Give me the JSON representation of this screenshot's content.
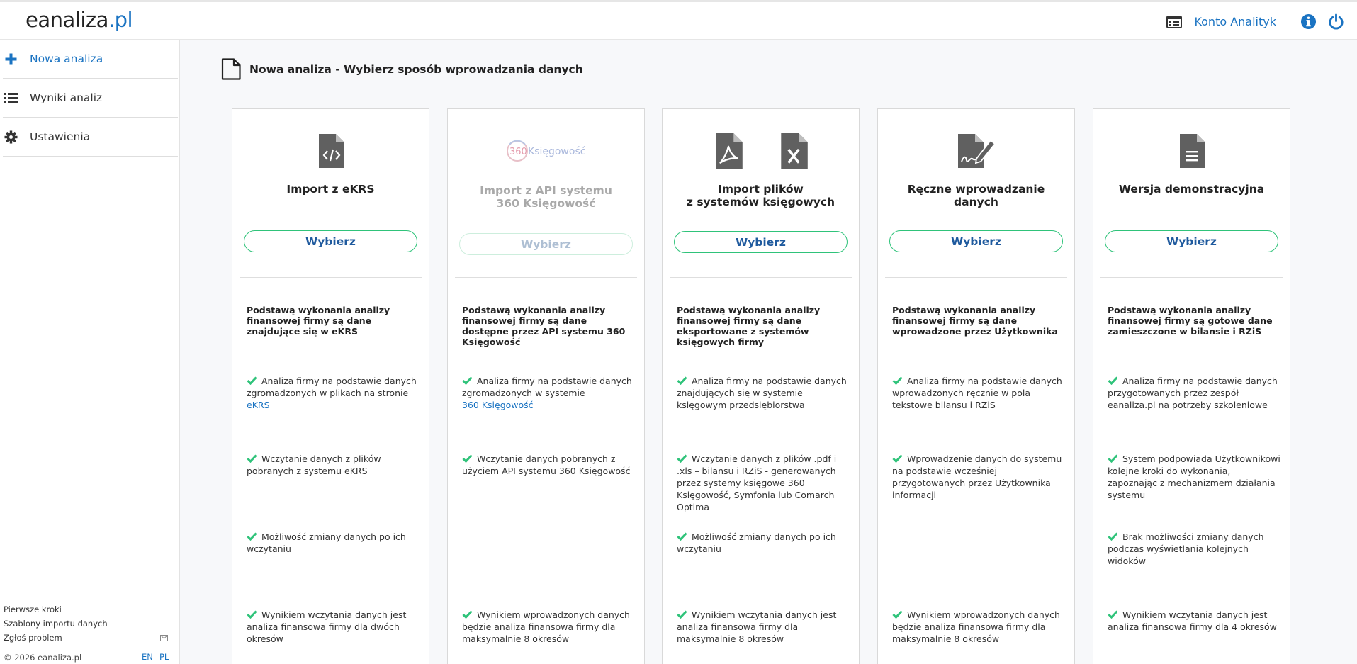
{
  "header": {
    "logo_part1": "eanaliza",
    "logo_part2": ".pl",
    "account_label": "Konto Analityk",
    "icons": [
      "account-list-icon",
      "info-icon",
      "power-icon"
    ]
  },
  "sidebar": {
    "items": [
      {
        "label": "Nowa analiza",
        "icon": "plus-icon"
      },
      {
        "label": "Wyniki analiz",
        "icon": "list-icon"
      },
      {
        "label": "Ustawienia",
        "icon": "gear-icon"
      }
    ],
    "footer_links": [
      "Pierwsze kroki",
      "Szablony importu danych",
      "Zgłoś problem"
    ],
    "copyright": "© 2026 eanaliza.pl",
    "lang_en": "EN",
    "lang_pl": "PL"
  },
  "main": {
    "title": "Nowa analiza - Wybierz sposób wprowadzania danych",
    "cards": [
      {
        "title_lines": [
          "Import z eKRS",
          ""
        ],
        "button": "Wybierz",
        "basis": "Podstawą wykonania analizy finansowej firmy są dane znajdujące się w eKRS",
        "features": [
          {
            "text": "Analiza firmy na podstawie danych zgromadzonych w plikach na stronie",
            "link": "eKRS"
          },
          {
            "text": "Wczytanie danych z plików pobranych z systemu eKRS",
            "link": ""
          },
          {
            "text": "Możliwość zmiany danych po ich wczytaniu",
            "link": ""
          },
          {
            "text": "Wynikiem wczytania danych jest analiza finansowa firmy dla dwóch okresów",
            "link": ""
          }
        ]
      },
      {
        "title_lines": [
          "Import z API systemu",
          "360 Księgowość"
        ],
        "logo_text_1": "360",
        "logo_text_2": "Księgowość",
        "button": "Wybierz",
        "basis": "Podstawą wykonania analizy finansowej firmy są dane dostępne przez API systemu 360 Księgowość",
        "features": [
          {
            "text": "Analiza firmy na podstawie danych zgromadzonych w systemie",
            "link": "360 Księgowość"
          },
          {
            "text": "Wczytanie danych pobranych z użyciem API systemu 360 Księgowość",
            "link": ""
          },
          {
            "text": "",
            "link": ""
          },
          {
            "text": "Wynikiem wprowadzonych danych będzie analiza finansowa firmy dla maksymalnie 8 okresów",
            "link": ""
          }
        ]
      },
      {
        "title_lines": [
          "Import plików",
          "z systemów księgowych"
        ],
        "button": "Wybierz",
        "basis": "Podstawą wykonania analizy finansowej firmy są dane eksportowane z systemów księgowych firmy",
        "features": [
          {
            "text": "Analiza firmy na podstawie danych znajdujących się w systemie księgowym przedsiębiorstwa",
            "link": ""
          },
          {
            "text": "Wczytanie danych z plików .pdf i .xls – bilansu i RZiS - generowanych przez systemy księgowe 360 Księgowość, Symfonia lub Comarch Optima",
            "link": ""
          },
          {
            "text": "Możliwość zmiany danych po ich wczytaniu",
            "link": ""
          },
          {
            "text": "Wynikiem wczytania danych jest analiza finansowa firmy dla maksymalnie 8 okresów",
            "link": ""
          }
        ]
      },
      {
        "title_lines": [
          "Ręczne wprowadzanie danych",
          ""
        ],
        "button": "Wybierz",
        "basis": "Podstawą wykonania analizy finansowej firmy są dane wprowadzone przez Użytkownika",
        "features": [
          {
            "text": "Analiza firmy na podstawie danych wprowadzonych ręcznie w pola tekstowe bilansu i RZiS",
            "link": ""
          },
          {
            "text": "Wprowadzenie danych do systemu na podstawie wcześniej przygotowanych przez Użytkownika informacji",
            "link": ""
          },
          {
            "text": "",
            "link": ""
          },
          {
            "text": "Wynikiem wprowadzonych danych będzie analiza finansowa firmy dla maksymalnie 8 okresów",
            "link": ""
          }
        ]
      },
      {
        "title_lines": [
          "Wersja demonstracyjna",
          ""
        ],
        "button": "Wybierz",
        "basis": "Podstawą wykonania analizy finansowej firmy są gotowe dane zamieszczone w bilansie i RZiS",
        "features": [
          {
            "text": "Analiza firmy na podstawie danych przygotowanych przez zespół eanaliza.pl na potrzeby szkoleniowe",
            "link": ""
          },
          {
            "text": "System podpowiada Użytkownikowi kolejne kroki do wykonania, zapoznając z mechanizmem działania systemu",
            "link": ""
          },
          {
            "text": "Brak możliwości zmiany danych podczas wyświetlania kolejnych widoków",
            "link": ""
          },
          {
            "text": "Wynikiem wczytania danych jest analiza finansowa firmy dla 4 okresów",
            "link": ""
          }
        ]
      }
    ]
  },
  "colors": {
    "brand": "#1a73c2",
    "check": "#2fc37a",
    "button_text": "#1f5a9e"
  }
}
